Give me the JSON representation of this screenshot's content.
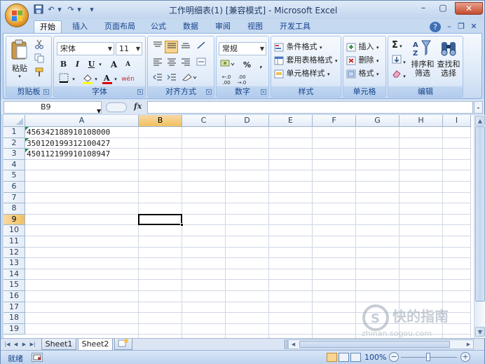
{
  "window": {
    "title": "工作明细表(1)  [兼容模式] - Microsoft Excel"
  },
  "quick_access": {
    "undo": "↶",
    "redo": "↷",
    "customize": "▾"
  },
  "window_controls": {
    "minimize": "–",
    "maximize": "▢",
    "close": "✕"
  },
  "ribbon_controls": {
    "help": "?",
    "minimize": "–",
    "restore": "❐",
    "close": "✕"
  },
  "tabs": [
    "开始",
    "插入",
    "页面布局",
    "公式",
    "数据",
    "审阅",
    "视图",
    "开发工具"
  ],
  "active_tab": "开始",
  "ribbon": {
    "clipboard": {
      "label": "剪贴板",
      "paste": "粘贴"
    },
    "font": {
      "label": "字体",
      "name": "宋体",
      "size": "11",
      "bold": "B",
      "italic": "I",
      "underline": "U",
      "grow": "A",
      "shrink": "A",
      "phonetic": "wén"
    },
    "alignment": {
      "label": "对齐方式"
    },
    "number": {
      "label": "数字",
      "format": "常规",
      "percent": "%",
      "comma": ",",
      "inc_decimal": "←.0 .00",
      "dec_decimal": ".00 →.0"
    },
    "styles": {
      "label": "样式",
      "conditional": "条件格式",
      "table": "套用表格格式",
      "cell": "单元格样式"
    },
    "cells": {
      "label": "单元格",
      "insert": "插入",
      "delete": "删除",
      "format": "格式"
    },
    "editing": {
      "label": "编辑",
      "sum": "Σ",
      "sort_filter": "排序和\n筛选",
      "find_select": "查找和\n选择"
    }
  },
  "formula_bar": {
    "name_box": "B9",
    "fx": "fx",
    "formula": ""
  },
  "columns": [
    "A",
    "B",
    "C",
    "D",
    "E",
    "F",
    "G",
    "H",
    "I"
  ],
  "rows": [
    "1",
    "2",
    "3",
    "4",
    "5",
    "6",
    "7",
    "8",
    "9",
    "10",
    "11",
    "12",
    "13",
    "14",
    "15",
    "16",
    "17",
    "18",
    "19"
  ],
  "cells": {
    "A1": "456342188910108000",
    "A2": "350120199312100427",
    "A3": "450112199910108947"
  },
  "selected_cell": "B9",
  "sheets": [
    "Sheet1",
    "Sheet2"
  ],
  "active_sheet": "Sheet2",
  "status": {
    "ready": "就绪",
    "zoom": "100%"
  },
  "watermark": {
    "text": "快的指南",
    "sub": "zhinan.sogou.com"
  },
  "colors": {
    "accent": "#15428b",
    "selected_header": "#f1c15f",
    "number_text_marker": "#1c8c3a"
  }
}
